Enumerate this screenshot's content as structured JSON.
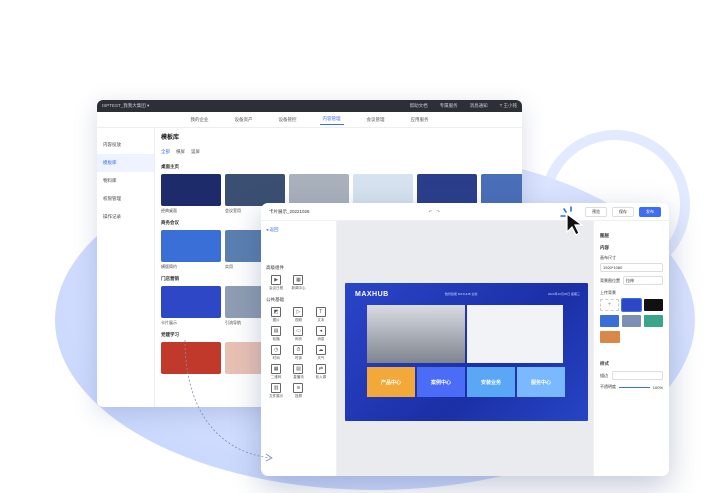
{
  "back_window": {
    "topbar": {
      "brand": "ISPTEST_我我大集团 ▾",
      "actions": [
        "帮助文档",
        "专属服务",
        "消息通知",
        "T 王小铭"
      ]
    },
    "nav": [
      {
        "label": "我的企业",
        "active": false
      },
      {
        "label": "设备资产",
        "active": false
      },
      {
        "label": "设备管控",
        "active": false
      },
      {
        "label": "内容管理",
        "active": true
      },
      {
        "label": "会议管理",
        "active": false
      },
      {
        "label": "应用服务",
        "active": false
      }
    ],
    "sidebar": [
      {
        "label": "内容投放",
        "active": false
      },
      {
        "label": "模板库",
        "active": true
      },
      {
        "label": "物料库",
        "active": false
      },
      {
        "label": "权限管理",
        "active": false
      },
      {
        "label": "操作记录",
        "active": false
      }
    ],
    "title": "模板库",
    "filters": [
      {
        "label": "全部",
        "active": true
      },
      {
        "label": "横屏",
        "active": false
      },
      {
        "label": "竖屏",
        "active": false
      }
    ],
    "sections": [
      {
        "title": "桌面主页",
        "cards": [
          {
            "label": "经典桌面",
            "color": "#1d2b6b"
          },
          {
            "label": "会议室用",
            "color": "#3a4f72"
          },
          {
            "label": "",
            "color": "#a9b1bc"
          },
          {
            "label": "",
            "color": "#d6e2ef"
          },
          {
            "label": "",
            "color": "#2b3e8c"
          },
          {
            "label": "",
            "color": "#4a6fb8"
          }
        ]
      },
      {
        "title": "商务会议",
        "cards": [
          {
            "label": "横版简约",
            "color": "#3b6fd8"
          },
          {
            "label": "实用",
            "color": "#5b7fb0"
          }
        ]
      },
      {
        "title": "门店营销",
        "cards": [
          {
            "label": "卡片展示",
            "color": "#2d47c7"
          },
          {
            "label": "引流导航",
            "color": "#8e9db3"
          }
        ]
      },
      {
        "title": "党建学习",
        "cards": [
          {
            "label": "",
            "color": "#c0392b"
          },
          {
            "label": "",
            "color": "#e8c1b5"
          }
        ]
      }
    ]
  },
  "editor": {
    "file_title": "卡片展示_20221026",
    "undo": "↶",
    "redo": "↷",
    "buttons": {
      "preview": "预览",
      "save": "保存",
      "publish": "发布"
    },
    "back_link": "◂ 返回",
    "groups": [
      {
        "title": "高级组件",
        "items": [
          {
            "label": "会议日程",
            "glyph": "▶"
          },
          {
            "label": "新闻中心",
            "glyph": "▦"
          }
        ]
      },
      {
        "title": "公共基础",
        "items": [
          {
            "label": "图片",
            "glyph": "◩"
          },
          {
            "label": "视频",
            "glyph": "▷"
          },
          {
            "label": "文本",
            "glyph": "T"
          },
          {
            "label": "轮播",
            "glyph": "▤"
          },
          {
            "label": "网页",
            "glyph": "▭"
          },
          {
            "label": "消息",
            "glyph": "◂"
          },
          {
            "label": "时间",
            "glyph": "◷"
          },
          {
            "label": "时钟",
            "glyph": "⏱"
          },
          {
            "label": "天气",
            "glyph": "☁"
          },
          {
            "label": "二维码",
            "glyph": "▦"
          },
          {
            "label": "直播流",
            "glyph": "▤"
          },
          {
            "label": "轮入源",
            "glyph": "⇄"
          },
          {
            "label": "文件展示",
            "glyph": "▥"
          },
          {
            "label": "投屏",
            "glyph": "≋"
          }
        ]
      }
    ],
    "slide": {
      "logo": "MAXHUB",
      "subtitle": "数智赋能 MAXHUB 全新",
      "date": "2022年10月26日 星期三",
      "tiles": [
        {
          "label": "产品中心",
          "color": "#f3a93a"
        },
        {
          "label": "案例中心",
          "color": "#4a6cf7"
        },
        {
          "label": "安装业务",
          "color": "#5aa8f5"
        },
        {
          "label": "服务中心",
          "color": "#7ab8ff"
        }
      ]
    },
    "right_panel": {
      "section": "图层",
      "content_label": "内容",
      "size_label": "画布尺寸",
      "size_value": "1920*1080",
      "bg_position_label": "背景图位置",
      "bg_position_value": "拉伸",
      "upload_label": "上传背景",
      "style_label": "样式",
      "border_label": "描边",
      "opacity_label": "不透明度",
      "opacity_value": "100%",
      "swatches": [
        "#ffffff",
        "#2d47c7",
        "#111111",
        "#3b6fd8",
        "#7d8fb5",
        "#3aa58a",
        "#d9884a"
      ]
    }
  }
}
